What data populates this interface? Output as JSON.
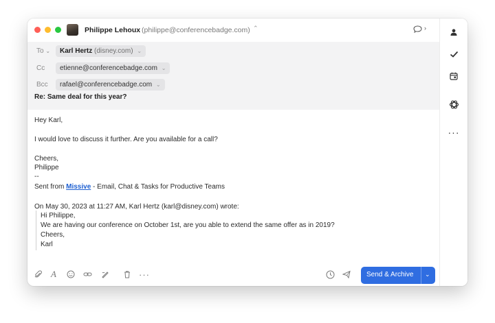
{
  "window": {
    "controls": {
      "close_color": "#ff5f57",
      "minimize_color": "#febc2e",
      "zoom_color": "#28c840"
    }
  },
  "sender": {
    "name": "Philippe Lehoux",
    "address": "(philippe@conferencebadge.com)",
    "caret": "⌃"
  },
  "header_tools": {
    "chat_icon": "chat-bubble-icon",
    "caret": "›"
  },
  "recipients": {
    "to": {
      "label": "To",
      "label_caret": "⌄",
      "name": "Karl Hertz",
      "domain": "(disney.com)",
      "caret": "⌄"
    },
    "cc": {
      "label": "Cc",
      "address": "etienne@conferencebadge.com",
      "caret": "⌄"
    },
    "bcc": {
      "label": "Bcc",
      "address": "rafael@conferencebadge.com",
      "caret": "⌄"
    }
  },
  "subject": "Re: Same deal for this year?",
  "body": {
    "greeting": "Hey Karl,",
    "message": "I would love to discuss it further. Are you available for a call?",
    "signoff": "Cheers,",
    "signature_name": "Philippe",
    "separator": "--",
    "sent_prefix": "Sent from ",
    "sent_link": "Missive",
    "sent_suffix": " - Email, Chat & Tasks for Productive Teams"
  },
  "quoted": {
    "attribution": "On May 30, 2023 at 11:27 AM, Karl Hertz (karl@disney.com) wrote:",
    "lines": [
      "Hi Philippe,",
      "We are having our conference on October 1st, are you able to extend the same offer as in 2019?",
      "Cheers,",
      "Karl"
    ]
  },
  "toolbar": {
    "icons": [
      "paperclip-icon",
      "text-format-icon",
      "emoji-icon",
      "link-icon",
      "signature-icon",
      "trash-icon",
      "more-icon"
    ],
    "right_icons": [
      "schedule-icon",
      "snooze-send-icon"
    ],
    "send_label": "Send & Archive",
    "send_caret": "⌄",
    "accent_color": "#2f6de1"
  },
  "rail": {
    "icons": [
      "contact-icon",
      "check-icon",
      "calendar-icon",
      "openai-icon",
      "more-horizontal-icon"
    ]
  }
}
